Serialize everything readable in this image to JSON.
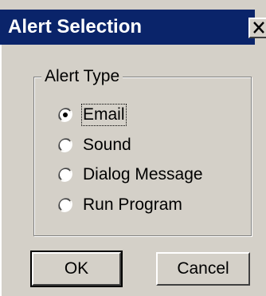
{
  "window": {
    "title": "Alert Selection",
    "close_icon": "close-icon",
    "title_bar_color": "#0a246a",
    "dialog_color": "#d4d0c8"
  },
  "alert_type": {
    "legend": "Alert Type",
    "options": [
      {
        "label": "Email",
        "selected": true
      },
      {
        "label": "Sound",
        "selected": false
      },
      {
        "label": "Dialog Message",
        "selected": false
      },
      {
        "label": "Run Program",
        "selected": false
      }
    ]
  },
  "buttons": {
    "ok_label": "OK",
    "cancel_label": "Cancel"
  }
}
